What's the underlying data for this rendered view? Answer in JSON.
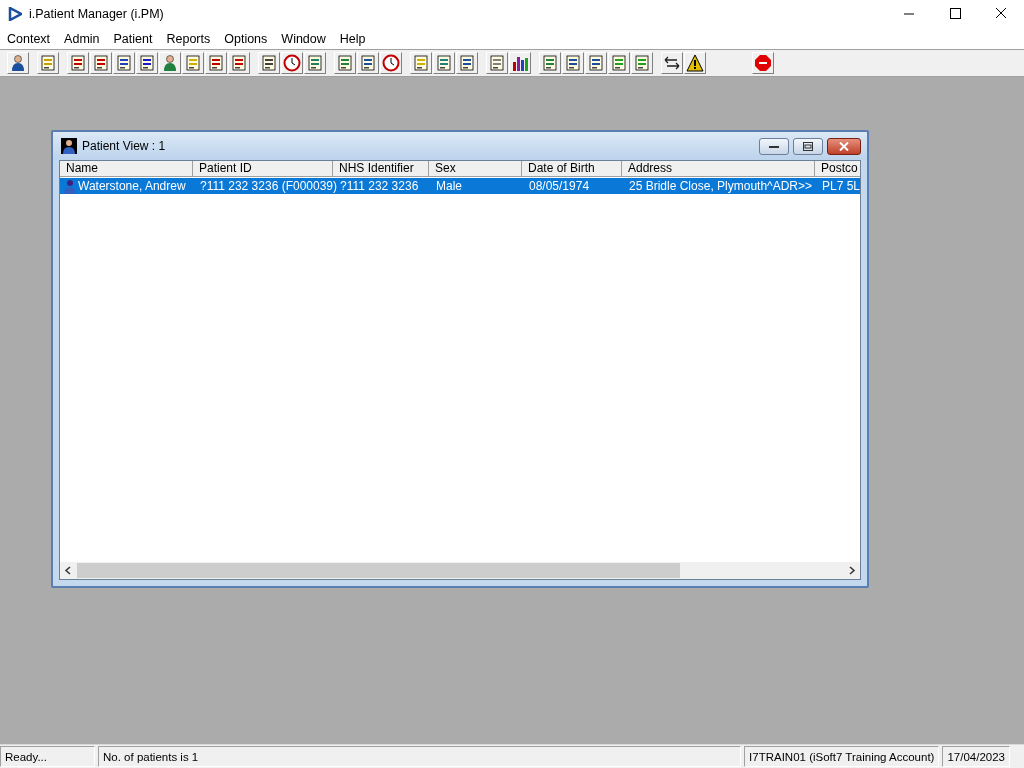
{
  "window": {
    "title": "i.Patient Manager (i.PM)"
  },
  "menu": [
    "Context",
    "Admin",
    "Patient",
    "Reports",
    "Options",
    "Window",
    "Help"
  ],
  "child_window": {
    "title": "Patient View : 1",
    "table": {
      "columns": [
        "Name",
        "Patient ID",
        "NHS Identifier",
        "Sex",
        "Date of Birth",
        "Address",
        "Postco"
      ],
      "rows": [
        {
          "selected": true,
          "cells": [
            "Waterstone, Andrew",
            "?111 232 3236 (F000039)",
            "?111 232 3236",
            "Male",
            "08/05/1974",
            "25 Bridle Close, Plymouth^ADR>>",
            "PL7 5L"
          ]
        }
      ]
    }
  },
  "status_bar": [
    "Ready...",
    "No. of patients is 1",
    "I7TRAIN01 (iSoft7 Training Account)",
    "17/04/2023"
  ]
}
